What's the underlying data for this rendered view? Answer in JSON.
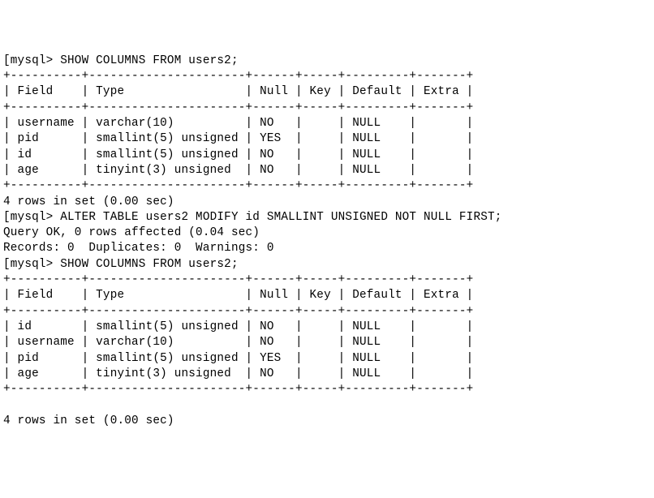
{
  "prompt": "mysql>",
  "cmd_show": "SHOW COLUMNS FROM users2;",
  "cmd_alter": "ALTER TABLE users2 MODIFY id SMALLINT UNSIGNED NOT NULL FIRST;",
  "query_ok": "Query OK, 0 rows affected (0.04 sec)",
  "records_line": "Records: 0  Duplicates: 0  Warnings: 0",
  "rows_summary": "4 rows in set (0.00 sec)",
  "border": "+----------+----------------------+------+-----+---------+-------+",
  "header": {
    "field": "Field",
    "type": "Type",
    "null": "Null",
    "key": "Key",
    "default": "Default",
    "extra": "Extra"
  },
  "table1": [
    {
      "field": "username",
      "type": "varchar(10)",
      "null": "NO",
      "key": "",
      "default": "NULL",
      "extra": ""
    },
    {
      "field": "pid",
      "type": "smallint(5) unsigned",
      "null": "YES",
      "key": "",
      "default": "NULL",
      "extra": ""
    },
    {
      "field": "id",
      "type": "smallint(5) unsigned",
      "null": "NO",
      "key": "",
      "default": "NULL",
      "extra": ""
    },
    {
      "field": "age",
      "type": "tinyint(3) unsigned",
      "null": "NO",
      "key": "",
      "default": "NULL",
      "extra": ""
    }
  ],
  "table2": [
    {
      "field": "id",
      "type": "smallint(5) unsigned",
      "null": "NO",
      "key": "",
      "default": "NULL",
      "extra": ""
    },
    {
      "field": "username",
      "type": "varchar(10)",
      "null": "NO",
      "key": "",
      "default": "NULL",
      "extra": ""
    },
    {
      "field": "pid",
      "type": "smallint(5) unsigned",
      "null": "YES",
      "key": "",
      "default": "NULL",
      "extra": ""
    },
    {
      "field": "age",
      "type": "tinyint(3) unsigned",
      "null": "NO",
      "key": "",
      "default": "NULL",
      "extra": ""
    }
  ],
  "chart_data": {
    "type": "table",
    "title": "SHOW COLUMNS FROM users2 (before and after ALTER TABLE MODIFY ... FIRST)",
    "columns": [
      "Field",
      "Type",
      "Null",
      "Key",
      "Default",
      "Extra"
    ],
    "before": [
      [
        "username",
        "varchar(10)",
        "NO",
        "",
        "NULL",
        ""
      ],
      [
        "pid",
        "smallint(5) unsigned",
        "YES",
        "",
        "NULL",
        ""
      ],
      [
        "id",
        "smallint(5) unsigned",
        "NO",
        "",
        "NULL",
        ""
      ],
      [
        "age",
        "tinyint(3) unsigned",
        "NO",
        "",
        "NULL",
        ""
      ]
    ],
    "after": [
      [
        "id",
        "smallint(5) unsigned",
        "NO",
        "",
        "NULL",
        ""
      ],
      [
        "username",
        "varchar(10)",
        "NO",
        "",
        "NULL",
        ""
      ],
      [
        "pid",
        "smallint(5) unsigned",
        "YES",
        "",
        "NULL",
        ""
      ],
      [
        "age",
        "tinyint(3) unsigned",
        "NO",
        "",
        "NULL",
        ""
      ]
    ]
  }
}
